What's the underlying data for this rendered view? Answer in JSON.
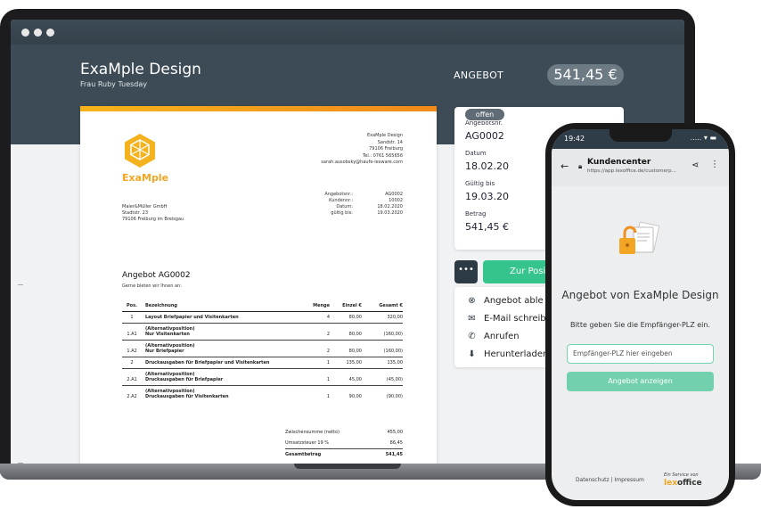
{
  "app": {
    "company_name": "ExaMple Design",
    "contact_name": "Frau Ruby Tuesday",
    "doc_type": "ANGEBOT",
    "amount": "541,45 €"
  },
  "document": {
    "logo_text": "ExaMple",
    "sender": [
      "ExaMple Design",
      "Sandstr. 14",
      "79106 Freiburg",
      "Tel.: 0761 565656",
      "sarah.ausobsky@haufe-lexware.com"
    ],
    "recipient": [
      "Maier&Müller GmbH",
      "Stadtstr. 23",
      "79106 Freiburg im Breisgau"
    ],
    "meta": [
      {
        "label": "Angebotsnr.:",
        "value": "AG0002"
      },
      {
        "label": "Kundennr.:",
        "value": "10002"
      },
      {
        "label": "Datum:",
        "value": "18.02.2020"
      },
      {
        "label": "gültig bis:",
        "value": "19.03.2020"
      }
    ],
    "title": "Angebot AG0002",
    "intro": "Gerne bieten wir Ihnen an:",
    "columns": {
      "pos": "Pos.",
      "desc": "Bezeichnung",
      "qty": "Menge",
      "unit": "Einzel €",
      "total": "Gesamt €"
    },
    "items": [
      {
        "pos": "1",
        "desc": "Layout Briefpapier und Visitenkarten",
        "sub": "",
        "qty": "4",
        "unit": "80,00",
        "total": "320,00"
      },
      {
        "pos": "1.A1",
        "desc": "(Alternativposition)",
        "sub": "Nur Visitenkarten",
        "qty": "2",
        "unit": "80,00",
        "total": "(160,00)"
      },
      {
        "pos": "1.A2",
        "desc": "(Alternativposition)",
        "sub": "Nur Briefpapier",
        "qty": "2",
        "unit": "80,00",
        "total": "(160,00)"
      },
      {
        "pos": "2",
        "desc": "Druckausgaben für Briefpapier und Visitenkarten",
        "sub": "",
        "qty": "1",
        "unit": "135,00",
        "total": "135,00"
      },
      {
        "pos": "2.A1",
        "desc": "(Alternativposition)",
        "sub": "Druckausgaben für Briefpapier",
        "qty": "1",
        "unit": "45,00",
        "total": "(45,00)"
      },
      {
        "pos": "2.A2",
        "desc": "(Alternativposition)",
        "sub": "Druckausgaben für Visitenkarten",
        "qty": "1",
        "unit": "90,00",
        "total": "(90,00)"
      }
    ],
    "totals": [
      {
        "label": "Zwischensumme (netto)",
        "value": "455,00"
      },
      {
        "label": "Umsatzsteuer 19 %",
        "value": "86,45"
      },
      {
        "label": "Gesamtbetrag",
        "value": "541,45"
      }
    ]
  },
  "panel": {
    "status": "offen",
    "fields": [
      {
        "label": "Angebotsnr.",
        "value": "AG0002"
      },
      {
        "label": "Datum",
        "value": "18.02.20"
      },
      {
        "label": "Gültig bis",
        "value": "19.03.20"
      },
      {
        "label": "Betrag",
        "value": "541,45 €"
      }
    ],
    "more_label": "•••",
    "primary_label": "Zur Posi",
    "actions": [
      {
        "icon": "close-circle-icon",
        "glyph": "⊗",
        "label": "Angebot able"
      },
      {
        "icon": "mail-icon",
        "glyph": "✉",
        "label": "E-Mail schreib"
      },
      {
        "icon": "phone-icon",
        "glyph": "✆",
        "label": "Anrufen"
      },
      {
        "icon": "download-icon",
        "glyph": "⬇",
        "label": "Herunterladen"
      }
    ]
  },
  "phone": {
    "time": "19:42",
    "status_right": "..... ▾ ▬",
    "title": "Kundencenter",
    "url": "https://app.lexoffice.de/customerp...",
    "heading": "Angebot von ExaMple Design",
    "subtext": "Bitte geben Sie die Empfänger-PLZ ein.",
    "input_placeholder": "Empfänger-PLZ hier eingeben",
    "button_label": "Angebot anzeigen",
    "footer": "Datenschutz | Impressum",
    "service_label": "Ein Service von",
    "brand_prefix": "lex",
    "brand_suffix": "office"
  },
  "colors": {
    "header": "#3d4b56",
    "accent_orange": "#f2a623",
    "primary_green": "#35c48c",
    "phone_button": "#73d0ad"
  }
}
